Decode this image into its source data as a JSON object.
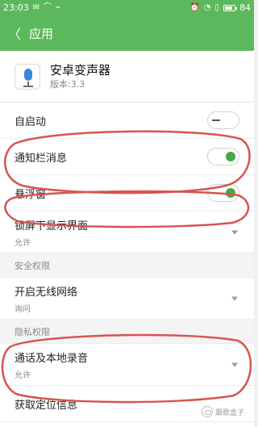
{
  "status_bar": {
    "time": "23:03",
    "left_icons": [
      "message-icon",
      "signal-icon",
      "usb-icon"
    ],
    "right_icons": [
      "alarm-icon",
      "wifi-icon",
      "sim-icon"
    ],
    "battery_percent": 84,
    "battery_label": "84"
  },
  "title_bar": {
    "back_icon": "chevron-left-icon",
    "title": "应用",
    "background": "#5cb85c"
  },
  "app": {
    "name": "安卓变声器",
    "version": "版本:3.3",
    "icon": "microphone-icon"
  },
  "settings": {
    "autostart": {
      "label": "自启动",
      "enabled": false
    },
    "notification": {
      "label": "通知栏消息",
      "enabled": true
    },
    "floating_window": {
      "label": "悬浮窗",
      "enabled": true
    },
    "lockscreen": {
      "label": "锁屏下显示界面",
      "value": "允许"
    }
  },
  "security_section": {
    "header": "安全权限",
    "wifi": {
      "label": "开启无线网络",
      "value": "询问"
    }
  },
  "privacy_section": {
    "header": "隐私权限",
    "recording": {
      "label": "通话及本地录音",
      "value": "允许"
    },
    "location": {
      "label": "获取定位信息"
    }
  },
  "watermark": {
    "text": "跟歌盒子"
  },
  "colors": {
    "accent": "#5cb85c",
    "toggle_on": "#45a745",
    "annotation": "#d9534f"
  }
}
